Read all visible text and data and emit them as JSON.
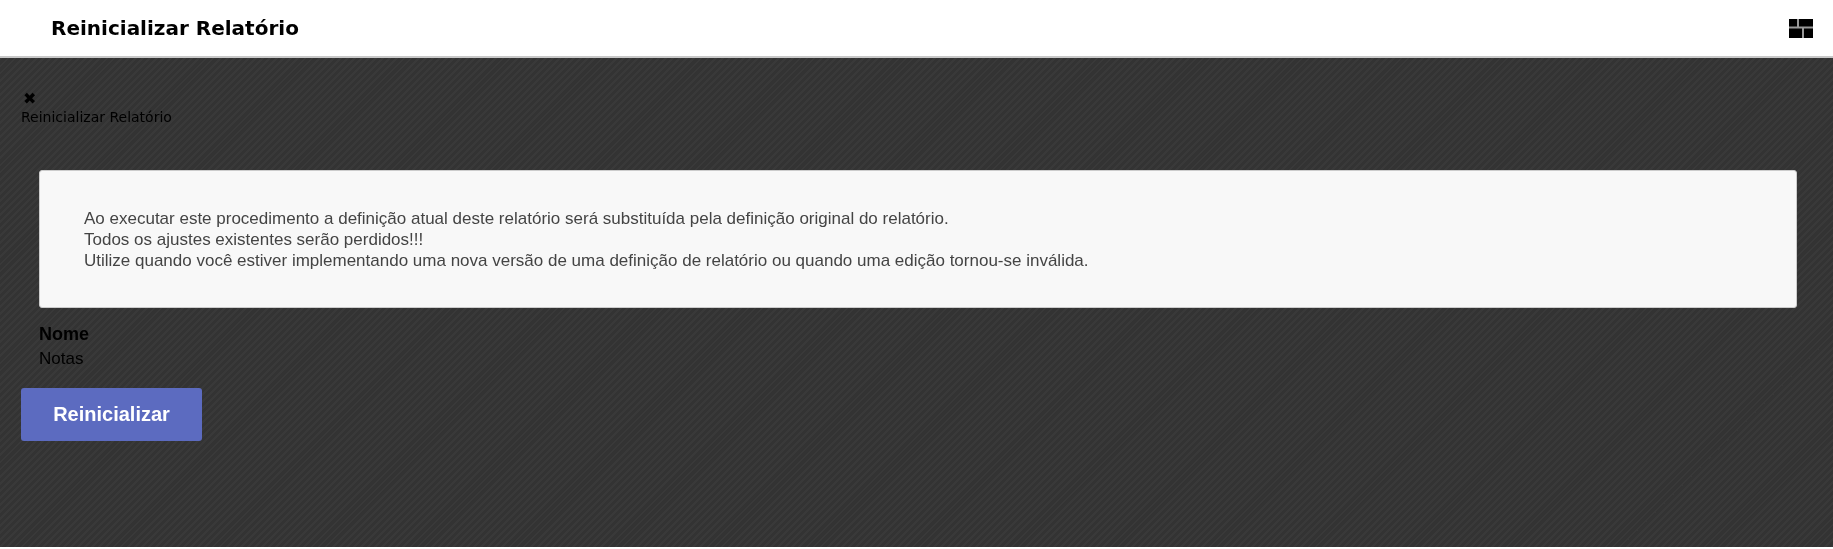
{
  "header": {
    "title": "Reinicializar Relatório"
  },
  "panel": {
    "close_label": "✖",
    "title": "Reinicializar Relatório"
  },
  "message": {
    "lines": [
      "Ao executar este procedimento a definição atual deste relatório será substituída pela definição original do relatório.",
      "Todos os ajustes existentes serão perdidos!!!",
      "Utilize quando você estiver implementando uma nova versão de uma definição de relatório ou quando uma edição tornou-se inválida."
    ]
  },
  "field": {
    "label": "Nome",
    "value": "Notas"
  },
  "buttons": [
    "Reinicializar"
  ]
}
